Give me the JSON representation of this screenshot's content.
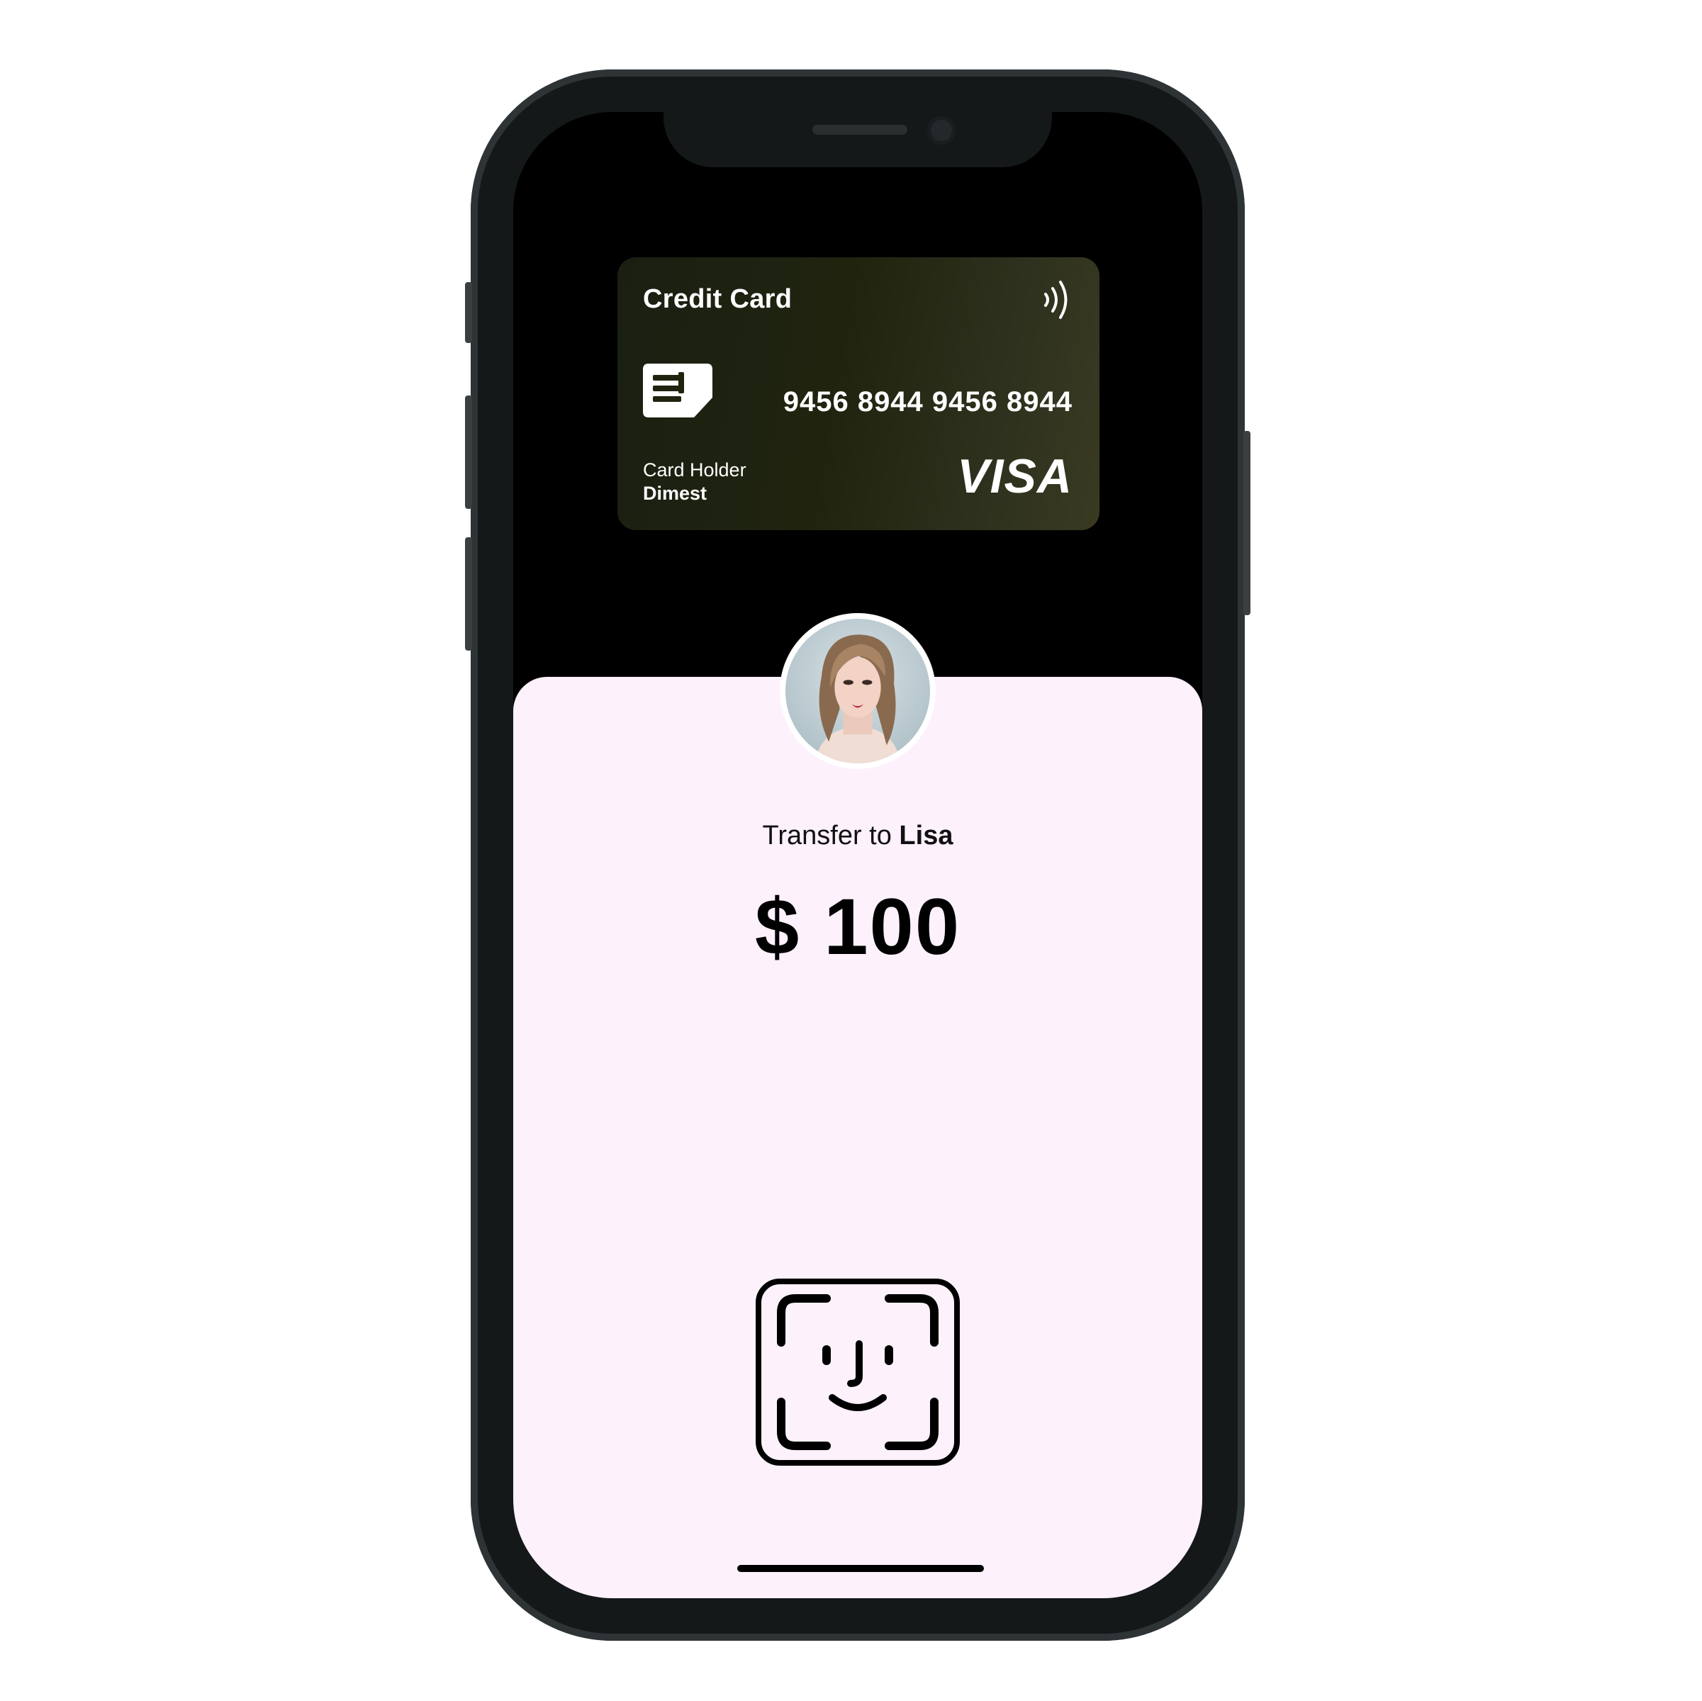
{
  "card": {
    "title": "Credit Card",
    "number": "9456 8944 9456 8944",
    "holder_label": "Card Holder",
    "holder_name": "Dimest",
    "network": "VISA",
    "contactless_icon": "nfc-icon",
    "chip_icon": "chip-icon"
  },
  "transfer": {
    "prefix": "Transfer to ",
    "recipient": "Lisa",
    "amount": "$ 100",
    "recipient_avatar": "avatar"
  },
  "auth": {
    "icon": "face-id-icon"
  },
  "colors": {
    "sheet_background": "#fdf1fc",
    "screen_background": "#000000",
    "card_gradient_start": "#1a1f12",
    "card_gradient_end": "#3a3a22"
  }
}
